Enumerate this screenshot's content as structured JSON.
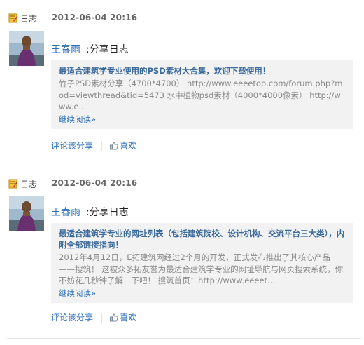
{
  "entries": [
    {
      "type_label": "日志",
      "type_icon": "diary-icon",
      "timestamp": "2012-06-04 20:16",
      "author": "王春雨",
      "action": ":分享日志",
      "card": {
        "title": "最适合建筑学专业使用的PSD素材大合集，欢迎下载使用！",
        "body": "竹子PSD素材分享（4700*4700） http://www.eeeetop.com/forum.php?mod=viewthread&tid=5473 水中植物psd素材（4000*4000像素） http://www.e...",
        "more": "继续阅读»"
      },
      "footer": {
        "share": "评论该分享",
        "divider": "|",
        "like": "喜欢"
      }
    },
    {
      "type_label": "日志",
      "type_icon": "diary-icon",
      "timestamp": "2012-06-04 20:16",
      "author": "王春雨",
      "action": ":分享日志",
      "card": {
        "title": "最适合建筑学专业的网址列表（包括建筑院校、设计机构、交流平台三大类），内附全部链接指向！",
        "body": "2012年4月12日，E拓建筑网经过2个月的开发，正式发布推出了其核心产品——搜筑！ 这被众多拓友誉为最适合建筑学专业的网址导航与网页搜索系统，你不妨花几秒钟了解一下吧！ 搜筑首页：http://www.eeeet...",
        "more": "继续阅读»"
      },
      "footer": {
        "share": "评论该分享",
        "divider": "|",
        "like": "喜欢"
      }
    }
  ],
  "colors": {
    "link": "#2a6fba",
    "card_title": "#3b6a9c",
    "card_bg": "#f2f2f2",
    "muted": "#8a8a8a"
  }
}
